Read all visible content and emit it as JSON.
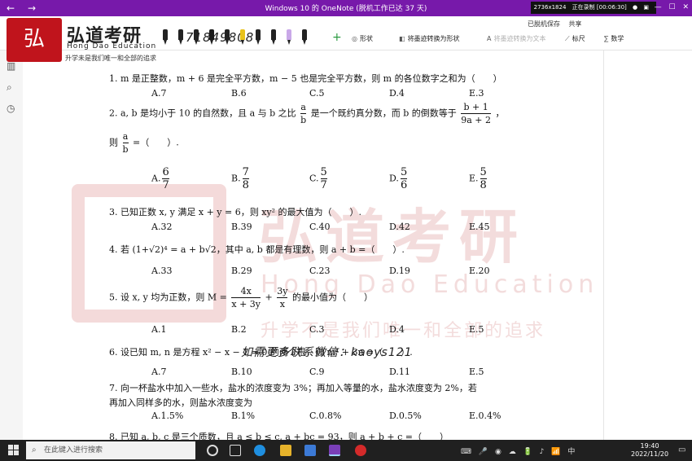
{
  "titlebar": {
    "back": "←",
    "forward": "→",
    "title": "Windows 10 的 OneNote (脱机工作已达 37 天)",
    "recorder": {
      "resolution": "2736x1824",
      "status": "正在录制 [00:06:30]"
    },
    "controls": [
      "—",
      "☐",
      "✕"
    ]
  },
  "ribbon": {
    "top_items": [
      "已脱机保存",
      "共享"
    ],
    "digits": "71849808",
    "plus": "+",
    "tools": [
      {
        "label": "形状",
        "icon": "shapes-icon"
      },
      {
        "label": "将墨迹转换为形状",
        "icon": "ink-to-shape-icon"
      },
      {
        "label": "将墨迹转换为文本",
        "icon": "ink-to-text-icon"
      },
      {
        "label": "标尺",
        "icon": "ruler-icon"
      },
      {
        "label": "数学",
        "icon": "math-icon"
      }
    ],
    "pen_colors": [
      "#222222",
      "#222222",
      "#222222",
      "#1a1a1a",
      "#222222",
      "#e8c21a",
      "#222222",
      "#222222",
      "#c9a8e8",
      "#222222"
    ]
  },
  "logo": {
    "seal_text": "弘",
    "title": "弘道考研",
    "english": "Hong Dao Education",
    "slogan": "升学未是我们唯一和全部的追求"
  },
  "watermark": {
    "title": "弘道考研",
    "english": "Hong Dao Education",
    "slogan": "升学不是我们唯一和全部的追求"
  },
  "questions": [
    {
      "q": "1. m 是正整数，m + 6 是完全平方数，m − 5 也是完全平方数，则 m 的各位数字之和为（　　）",
      "options": [
        "A.7",
        "B.6",
        "C.5",
        "D.4",
        "E.3"
      ]
    },
    {
      "q_a": "2. a, b 是均小于 10 的自然数，且 a 与 b 之比",
      "q_b": "是一个既约真分数，而 b 的倒数等于",
      "q_c": "，",
      "q2": "则",
      "q2b": "=（　　）.",
      "options": [
        "A.",
        "B.",
        "C.",
        "D.",
        "E."
      ],
      "fractions": [
        [
          "6",
          "7"
        ],
        [
          "7",
          "8"
        ],
        [
          "5",
          "7"
        ],
        [
          "5",
          "6"
        ],
        [
          "5",
          "8"
        ]
      ]
    },
    {
      "q": "3. 已知正数 x, y 满足 x + y = 6，则 xy² 的最大值为（　　）.",
      "options": [
        "A.32",
        "B.39",
        "C.40",
        "D.42",
        "E.45"
      ]
    },
    {
      "q": "4. 若 (1+√2)⁴ = a + b√2，其中 a, b 都是有理数，则 a + b =（　　）.",
      "options": [
        "A.33",
        "B.29",
        "C.23",
        "D.19",
        "E.20"
      ]
    },
    {
      "q_a": "5. 设 x, y 均为正数，则 M =",
      "q_b": "的最小值为（　　）",
      "options": [
        "A.1",
        "B.2",
        "C.3",
        "D.4",
        "E.5"
      ]
    },
    {
      "q": "6. 设已知 m, n 是方程 x² − x − 1 = 0 的两个根，则 m⁴ + 3n =（　　）.",
      "options": [
        "A.7",
        "B.10",
        "C.9",
        "D.11",
        "E.5"
      ]
    },
    {
      "q": "7. 向一杯盐水中加入一些水，盐水的浓度变为 3%；再加入等量的水，盐水浓度变为 2%，若",
      "q2": "再加入同样多的水，则盐水浓度变为",
      "options": [
        "A.1.5%",
        "B.1%",
        "C.0.8%",
        "D.0.5%",
        "E.0.4%"
      ]
    },
    {
      "q": "8. 已知 a, b, c 是三个质数，且 a ≤ b ≤ c, a + bc = 93，则 a + b + c =（　　）"
    }
  ],
  "wechat_note": "如需更多联系微信：kaoys121",
  "taskbar": {
    "search_placeholder": "在此键入进行搜索",
    "tray": [
      "⌨",
      "🎤",
      "◉",
      "☁",
      "🔋",
      "♪",
      "📶",
      "中"
    ],
    "time": "19:40",
    "date": "2022/11/20"
  }
}
